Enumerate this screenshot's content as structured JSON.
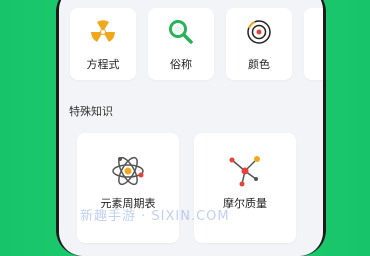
{
  "categories": [
    {
      "label": "方程式",
      "icon": "radiation-icon"
    },
    {
      "label": "俗称",
      "icon": "magnifier-icon"
    },
    {
      "label": "颜色",
      "icon": "color-disc-icon"
    }
  ],
  "section": {
    "title": "特殊知识"
  },
  "features": [
    {
      "label": "元素周期表",
      "icon": "atom-icon"
    },
    {
      "label": "摩尔质量",
      "icon": "molecule-icon"
    }
  ],
  "watermark": "新趣手游 · SIXIN.COM",
  "colors": {
    "accent_green": "#1fcf6f",
    "radiation": "#f2a81d",
    "magnifier": "#27b35a",
    "molecule": "#e4433a"
  }
}
